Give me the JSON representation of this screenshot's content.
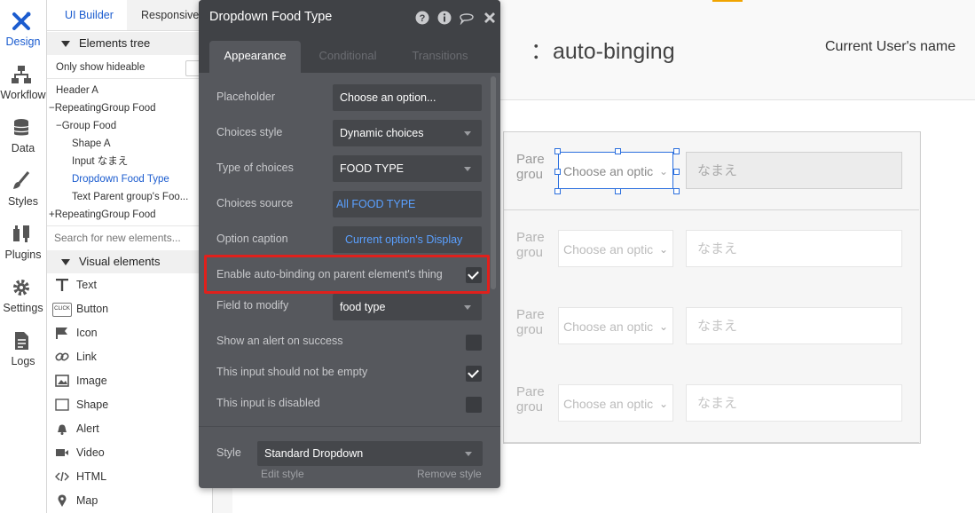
{
  "rail": [
    {
      "name": "design",
      "label": "Design",
      "icon": "design-icon"
    },
    {
      "name": "workflow",
      "label": "Workflow",
      "icon": "workflow-icon"
    },
    {
      "name": "data",
      "label": "Data",
      "icon": "database-icon"
    },
    {
      "name": "styles",
      "label": "Styles",
      "icon": "brush-icon"
    },
    {
      "name": "plugins",
      "label": "Plugins",
      "icon": "plug-icon"
    },
    {
      "name": "settings",
      "label": "Settings",
      "icon": "gear-icon"
    },
    {
      "name": "logs",
      "label": "Logs",
      "icon": "document-icon"
    }
  ],
  "panel": {
    "tabs": [
      "UI Builder",
      "Responsive"
    ],
    "tree_title": "Elements tree",
    "only_hideable": "Only show hideable",
    "tree": [
      "Header A",
      "RepeatingGroup Food",
      "Group Food",
      "Shape A",
      "Input なまえ",
      "Dropdown Food Type",
      "Text Parent group's Foo...",
      "RepeatingGroup Food"
    ],
    "search_placeholder": "Search for new elements...",
    "visual_title": "Visual elements",
    "visual": [
      "Text",
      "Button",
      "Icon",
      "Link",
      "Image",
      "Shape",
      "Alert",
      "Video",
      "HTML",
      "Map"
    ],
    "button_icon_text": "CLICK"
  },
  "canvas": {
    "title": "：auto-binging",
    "user": "Current User's name",
    "cell_parent": "Pare grou",
    "cell_dropdown": "Choose an optic",
    "cell_input": "なまえ"
  },
  "editor": {
    "title": "Dropdown Food Type",
    "tabs": [
      "Appearance",
      "Conditional",
      "Transitions"
    ],
    "placeholder_label": "Placeholder",
    "placeholder_value": "Choose an option...",
    "choices_style_label": "Choices style",
    "choices_style_value": "Dynamic choices",
    "type_label": "Type of choices",
    "type_value": "FOOD TYPE",
    "source_label": "Choices source",
    "source_value": "All FOOD TYPE",
    "caption_label": "Option caption",
    "caption_value": "Current option's Display",
    "autobind_label": "Enable auto-binding on parent element's thing",
    "autobind_checked": true,
    "field_label": "Field to modify",
    "field_value": "food type",
    "alert_label": "Show an alert on success",
    "alert_checked": false,
    "notempty_label": "This input should not be empty",
    "notempty_checked": true,
    "disabled_label": "This input is disabled",
    "disabled_checked": false,
    "style_label": "Style",
    "style_value": "Standard Dropdown",
    "edit_style": "Edit style",
    "remove_style": "Remove style"
  },
  "colors": {
    "accent": "#1b5ccf",
    "highlight": "#e0201c",
    "editor_bg": "#56585d"
  }
}
